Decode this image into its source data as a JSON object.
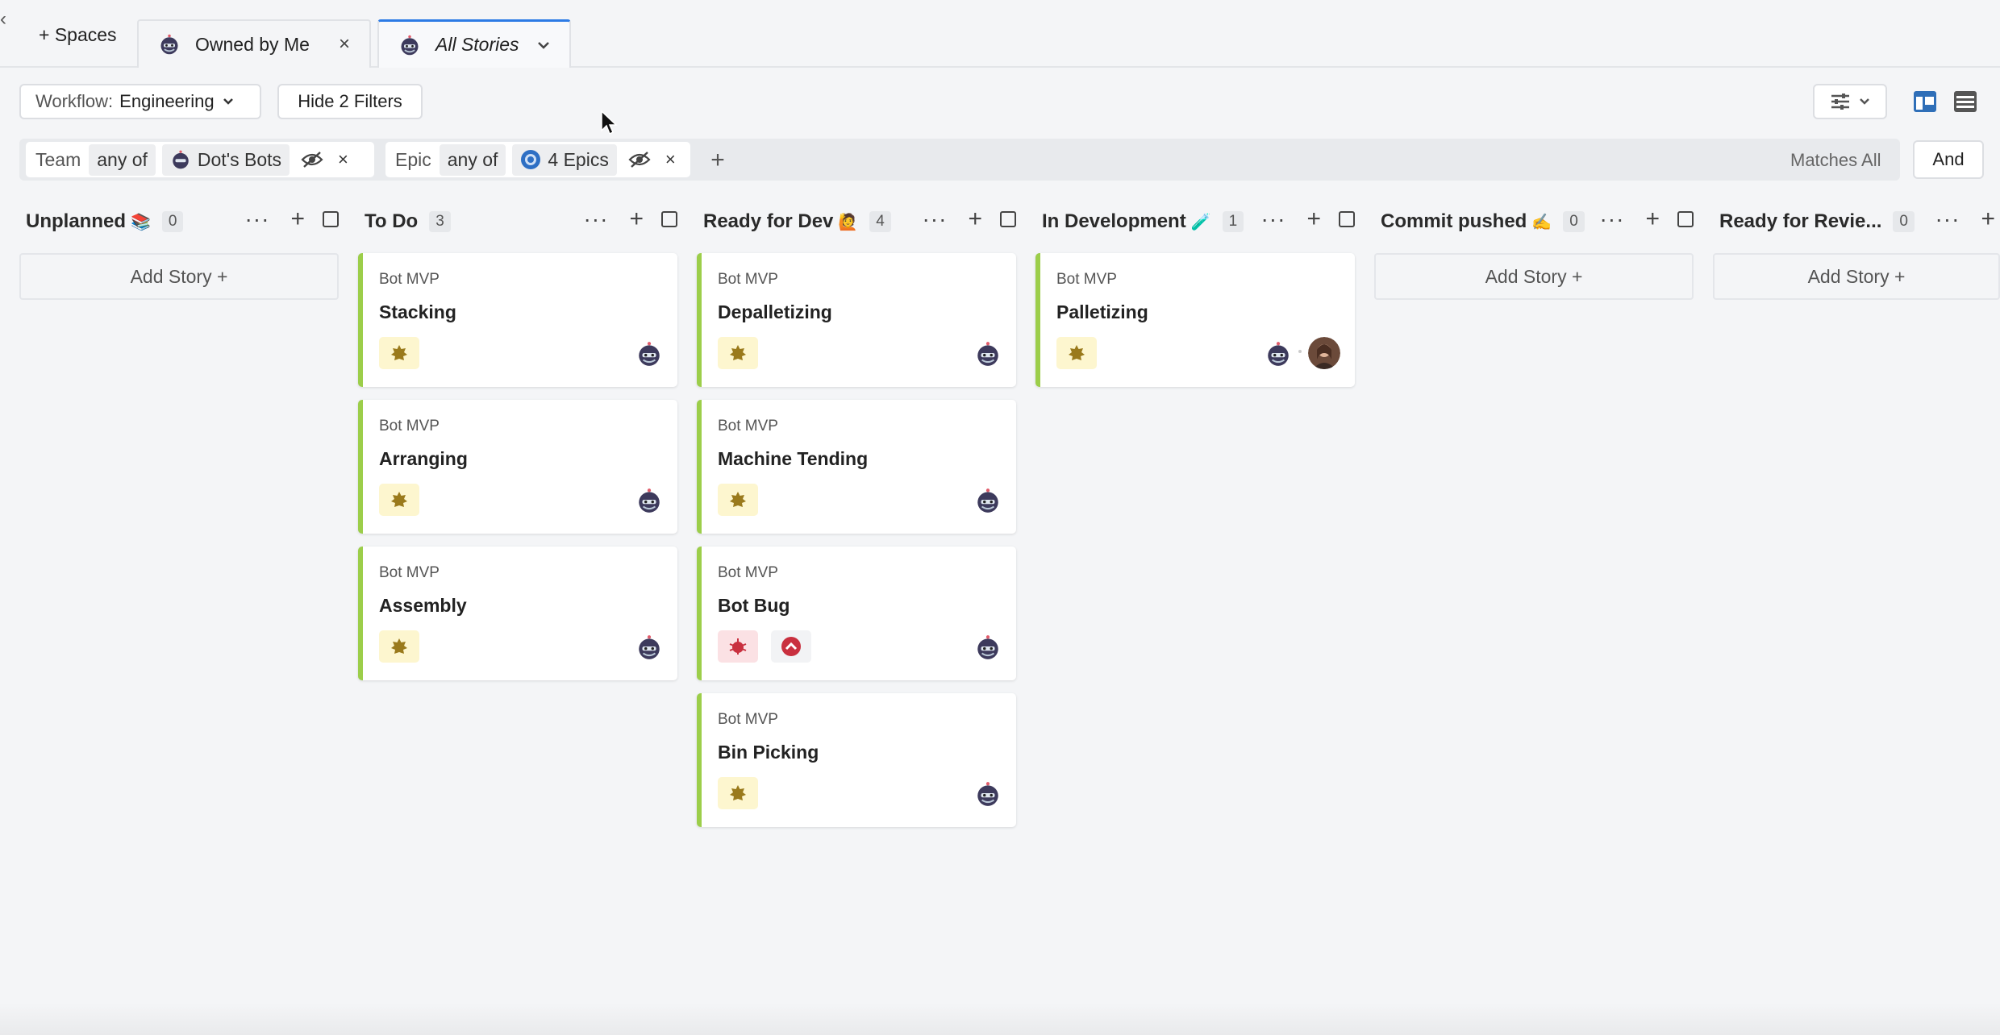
{
  "tabs": {
    "collapse": "‹",
    "spaces_label": "+ Spaces",
    "owned_label": "Owned by Me",
    "all_label": "All Stories",
    "close_glyph": "×",
    "chevron": "⌄"
  },
  "toolbar": {
    "workflow_key": "Workflow:",
    "workflow_value": "Engineering",
    "hide_filters": "Hide 2 Filters",
    "and_label": "And"
  },
  "filters": {
    "team": {
      "key": "Team",
      "op": "any of",
      "value": "Dot's Bots"
    },
    "epic": {
      "key": "Epic",
      "op": "any of",
      "value": "4 Epics"
    },
    "add": "+",
    "matches": "Matches All"
  },
  "columns": [
    {
      "title": "Unplanned",
      "emoji": "📚",
      "count": "0",
      "add_story": "Add Story +",
      "cards": []
    },
    {
      "title": "To Do",
      "emoji": "",
      "count": "3",
      "cards": [
        {
          "epic": "Bot MVP",
          "title": "Stacking"
        },
        {
          "epic": "Bot MVP",
          "title": "Arranging"
        },
        {
          "epic": "Bot MVP",
          "title": "Assembly"
        }
      ]
    },
    {
      "title": "Ready for Dev",
      "emoji": "🙋",
      "count": "4",
      "cards": [
        {
          "epic": "Bot MVP",
          "title": "Depalletizing"
        },
        {
          "epic": "Bot MVP",
          "title": "Machine Tending"
        },
        {
          "epic": "Bot MVP",
          "title": "Bot Bug"
        },
        {
          "epic": "Bot MVP",
          "title": "Bin Picking"
        }
      ]
    },
    {
      "title": "In Development",
      "emoji": "🧪",
      "count": "1",
      "cards": [
        {
          "epic": "Bot MVP",
          "title": "Palletizing"
        }
      ]
    },
    {
      "title": "Commit pushed",
      "emoji": "✍️",
      "count": "0",
      "add_story": "Add Story +",
      "cards": []
    },
    {
      "title": "Ready for Revie...",
      "emoji": "",
      "count": "0",
      "add_story": "Add Story +",
      "cards": []
    }
  ],
  "colors": {
    "accent": "#2d7be5",
    "card_stripe": "#9cce4a",
    "feature_badge_bg": "#fdf6cf",
    "bug_badge_bg": "#fbe1e4",
    "bug_red": "#c9303f"
  }
}
